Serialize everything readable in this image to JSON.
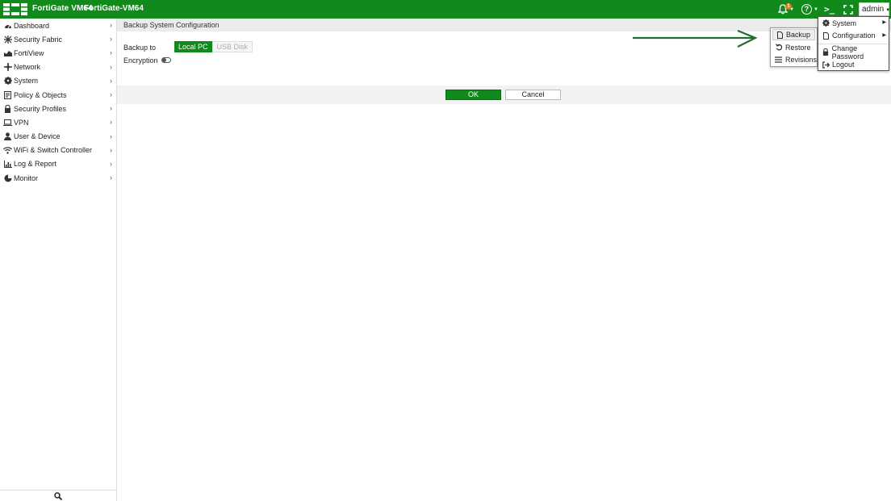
{
  "topbar": {
    "product": "FortiGate VM64",
    "hostname": "FortiGate-VM64",
    "notifications_count": "1",
    "cli_symbol": ">_",
    "user": "admin",
    "colors": {
      "brand": "#118a1c",
      "badge": "#e07b16"
    }
  },
  "sidebar": {
    "items": [
      {
        "label": "Dashboard",
        "icon": "dashboard-icon"
      },
      {
        "label": "Security Fabric",
        "icon": "security-fabric-icon"
      },
      {
        "label": "FortiView",
        "icon": "fortiview-icon"
      },
      {
        "label": "Network",
        "icon": "network-icon"
      },
      {
        "label": "System",
        "icon": "gear-icon"
      },
      {
        "label": "Policy & Objects",
        "icon": "policy-icon"
      },
      {
        "label": "Security Profiles",
        "icon": "lock-icon"
      },
      {
        "label": "VPN",
        "icon": "laptop-icon"
      },
      {
        "label": "User & Device",
        "icon": "user-icon"
      },
      {
        "label": "WiFi & Switch Controller",
        "icon": "wifi-icon"
      },
      {
        "label": "Log & Report",
        "icon": "chart-icon"
      },
      {
        "label": "Monitor",
        "icon": "pie-icon"
      }
    ],
    "search_icon": "search-icon"
  },
  "main": {
    "title": "Backup System Configuration",
    "backup_to_label": "Backup to",
    "backup_options": {
      "local": "Local PC",
      "usb": "USB Disk"
    },
    "selected_option": "Local PC",
    "encryption_label": "Encryption",
    "encryption_enabled": false,
    "ok_label": "OK",
    "cancel_label": "Cancel"
  },
  "user_menu": {
    "system": "System",
    "configuration": "Configuration",
    "change_password": "Change Password",
    "logout": "Logout"
  },
  "config_submenu": {
    "backup": "Backup",
    "restore": "Restore",
    "revisions": "Revisions"
  }
}
